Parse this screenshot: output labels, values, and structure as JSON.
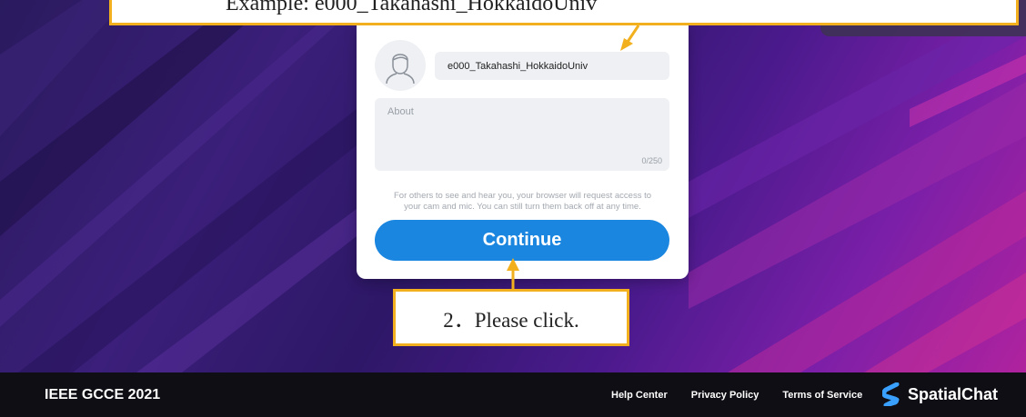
{
  "callouts": {
    "top_text": "Example: e000_Takahashi_HokkaidoUniv",
    "bottom_text": "2．Please click."
  },
  "profile_form": {
    "name_value": "e000_Takahashi_HokkaidoUniv",
    "about_placeholder": "About",
    "about_counter": "0/250",
    "notice_line1": "For others to see and hear you, your browser will request access to",
    "notice_line2": "your cam and mic. You can still turn them back off at any time.",
    "continue_label": "Continue",
    "avatar_icon": "user-outline-icon"
  },
  "footer": {
    "event_name": "IEEE GCCE 2021",
    "links": [
      "Help Center",
      "Privacy Policy",
      "Terms of Service"
    ],
    "brand_name": "SpatialChat"
  },
  "colors": {
    "callout_border": "#f2b01e",
    "button_blue": "#1a86e0",
    "footer_bg": "#0e0e14"
  }
}
